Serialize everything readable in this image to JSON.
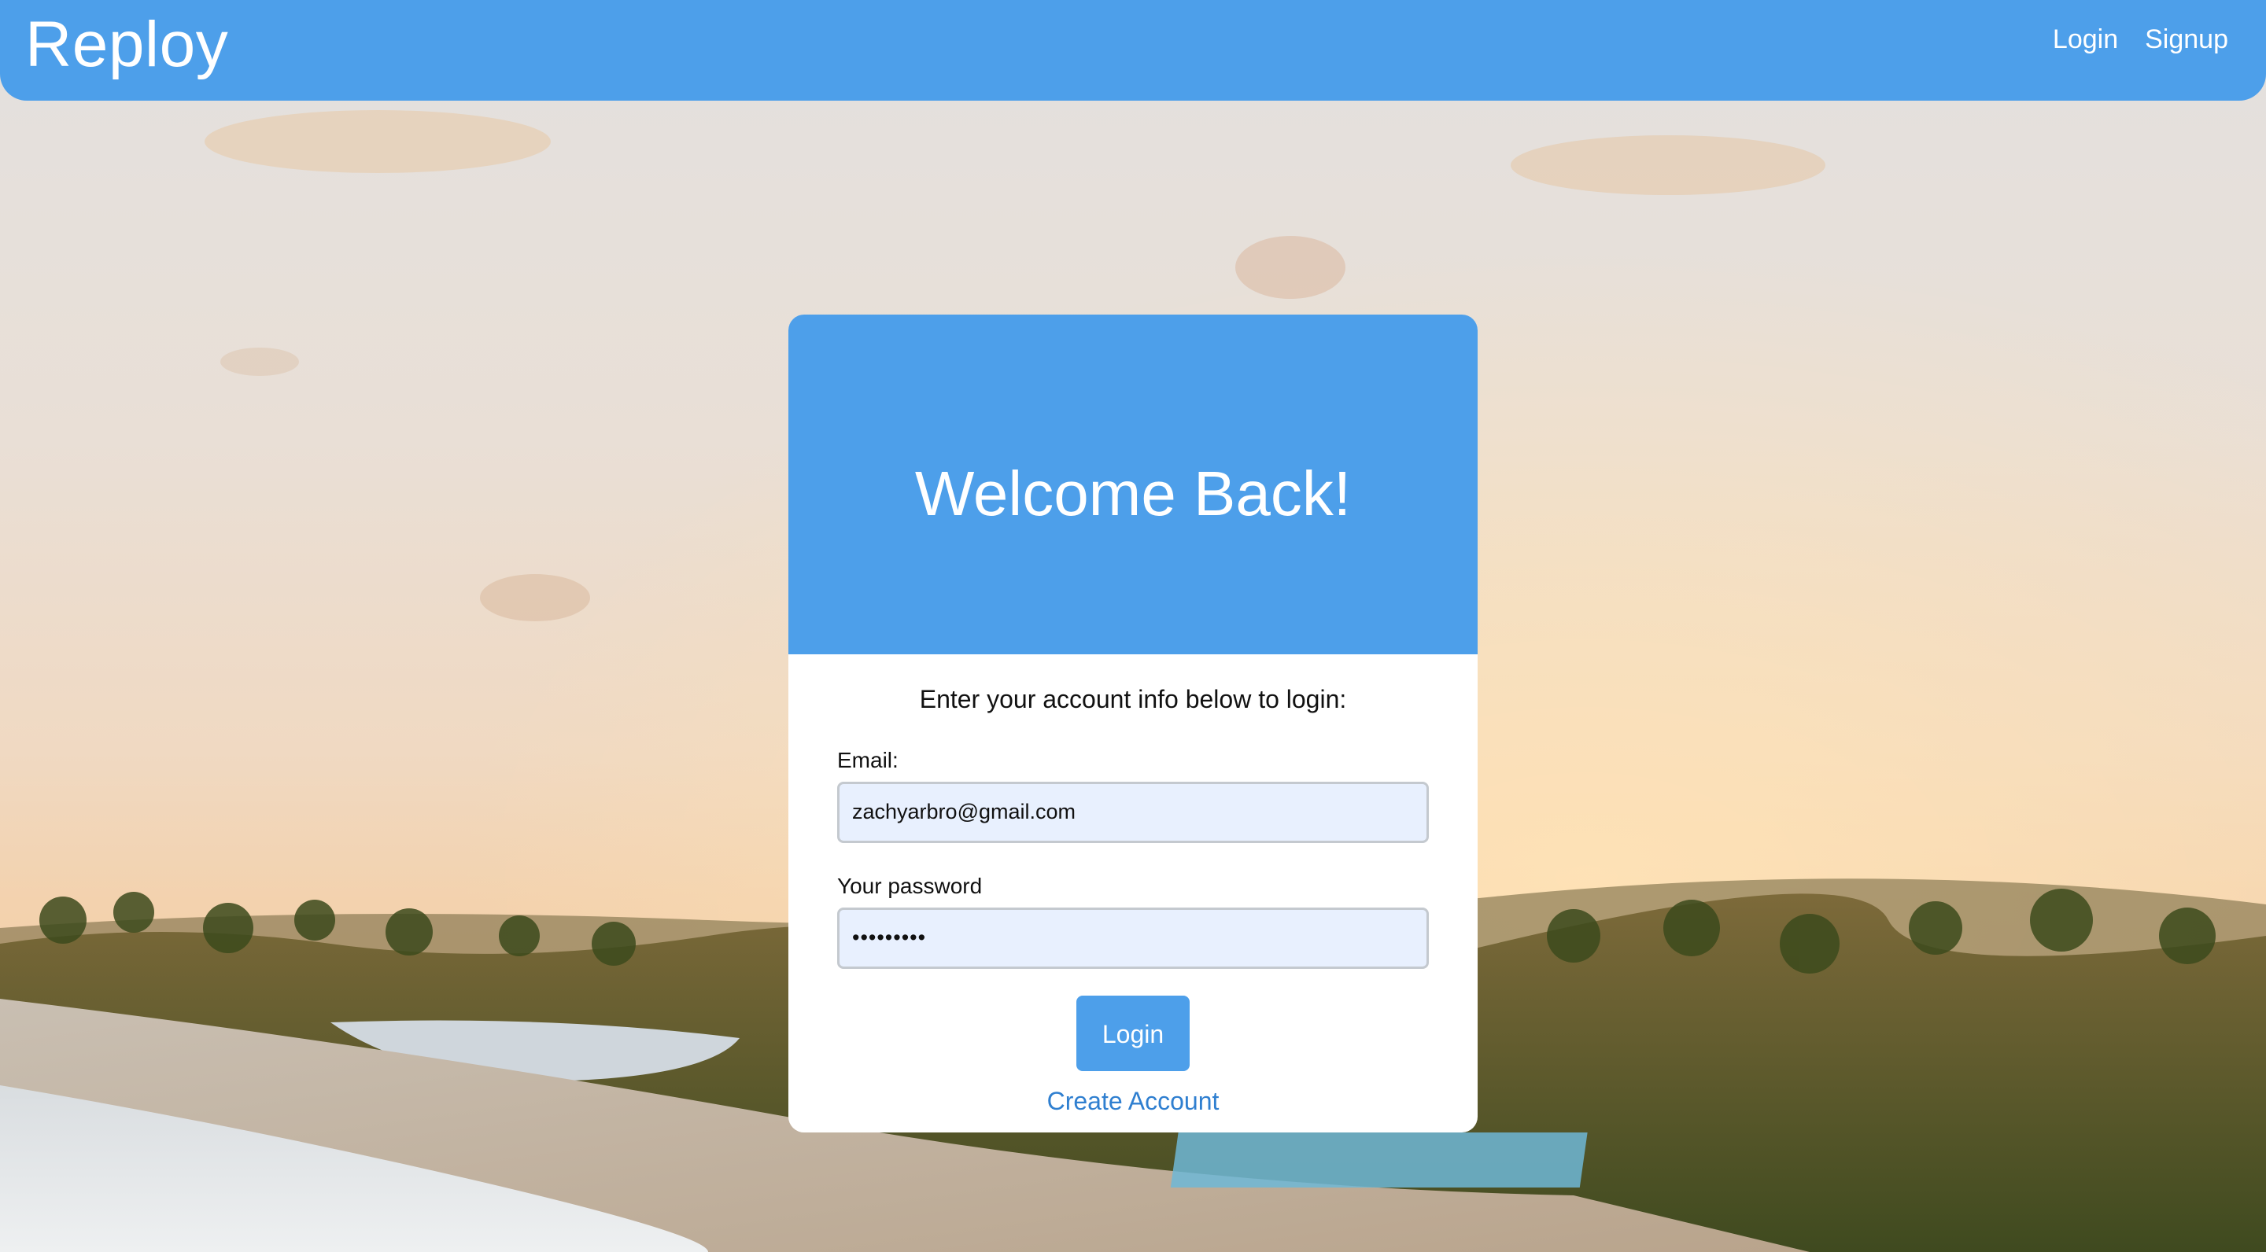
{
  "app": {
    "brand": "Reploy"
  },
  "nav": {
    "login_label": "Login",
    "signup_label": "Signup"
  },
  "card": {
    "title": "Welcome Back!",
    "subtitle": "Enter your account info below to login:",
    "email_label": "Email:",
    "email_value": "zachyarbro@gmail.com",
    "password_label": "Your password",
    "password_value": "•••••••••",
    "login_button_label": "Login",
    "create_account_label": "Create Account"
  },
  "colors": {
    "primary": "#4d9fea",
    "input_bg": "#e8f0fe",
    "link": "#2f7fd0"
  }
}
